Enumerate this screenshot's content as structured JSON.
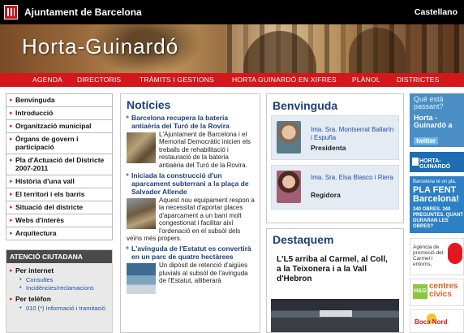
{
  "header": {
    "brand": "Ajuntament de Barcelona",
    "language_link": "Castellano"
  },
  "banner": {
    "title": "Horta-Guinardó"
  },
  "main_nav": [
    "AGENDA",
    "DIRECTORIS",
    "TRÀMITS I GESTIONS",
    "HORTA GUINARDÓ EN XIFRES",
    "PLÀNOL",
    "DISTRICTES"
  ],
  "sidebar": {
    "items": [
      "Benvinguda",
      "Introducció",
      "Organització municipal",
      "Òrgans de govern i participació",
      "Pla d'Actuació del Districte 2007-2011",
      "Història d'una vall",
      "El territori i els barris",
      "Situació del districte",
      "Webs d'interès",
      "Arquitectura"
    ]
  },
  "atencio": {
    "title": "ATENCIÓ CIUTADANA",
    "internet_heading": "Per internet",
    "internet_links": [
      "Consultes",
      "Incidències/reclamacions"
    ],
    "phone_heading": "Per telèfon",
    "phone_links": [
      "010 (*) Informació i tramitació"
    ]
  },
  "news": {
    "title": "Notícies",
    "items": [
      {
        "headline": "Barcelona recupera la bateria antiaèria del Turó de la Rovira",
        "body": "L'Ajuntament de Barcelona i el Memorial Democràtic inicien els treballs de rehabilitació i restauració de la bateria antiaèria del Turó de la Rovira."
      },
      {
        "headline": "Iniciada la construcció d'un aparcament subterrani a la plaça de Salvador Allende",
        "body": "Aquest nou equipament respon a la necessitat d'aportar places d'aparcament a un barri molt congestionat i facilitar així l'ordenació en el subsòl dels veïns més propers."
      },
      {
        "headline": "L'avinguda de l'Estatut es convertirà en un parc de quatre hectàrees",
        "body": "Un dipòsit de retenció d'aigües pluvials al subsòl de l'avinguda de l'Estatut, alliberarà"
      }
    ]
  },
  "welcome": {
    "title": "Benvinguda",
    "people": [
      {
        "name": "Ima. Sra. Montserrat Ballarín i Espuña",
        "role": "Presidenta"
      },
      {
        "name": "Ima. Sra. Elsa Blasco i Riera",
        "role": "Regidora"
      }
    ]
  },
  "highlight": {
    "title": "Destaquem",
    "text": "L'L5 arriba al Carmel, al Coll, a la Teixonera i a la Vall d'Hebron"
  },
  "right_banners": {
    "twitter_q": "Què està passant?",
    "twitter_h": "Horta - Guinardó a",
    "twitter_tag": "twitter",
    "horta_guinardo": "HORTA-GUINARDÓ",
    "pla_small": "Barcelona té un pla.",
    "pla_big": "PLA FENT Barcelona!",
    "pla_bottom": "340 OBRES. 340 PREGUNTES. QUANT DURARAN LES OBRES?",
    "agencia": "Agència de promoció del Carmel i entorns,",
    "centres": "centres cívics",
    "centres_icon": "H&G",
    "bocanord": "Boca Nord"
  },
  "colors": {
    "nav_red": "#d3171b",
    "title_blue": "#1d3f78",
    "link_blue": "#1f4ea3"
  }
}
